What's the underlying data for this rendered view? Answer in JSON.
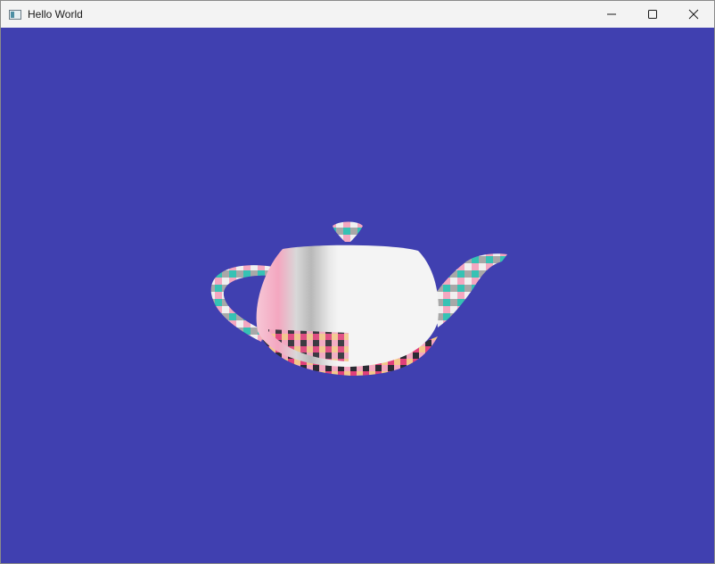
{
  "window": {
    "title": "Hello World",
    "background_color": "#4040b0",
    "icon": "app-window-icon"
  },
  "controls": {
    "minimize_icon": "minimize-icon",
    "maximize_icon": "maximize-icon",
    "close_icon": "close-icon"
  },
  "scene": {
    "object": "teapot",
    "texture": "checkerboard",
    "texture_colors": [
      "#f4a7c0",
      "#e0407a",
      "#2b2b33",
      "#a8a8a8",
      "#f0f0f0",
      "#36c2b4",
      "#f3c78a"
    ]
  }
}
